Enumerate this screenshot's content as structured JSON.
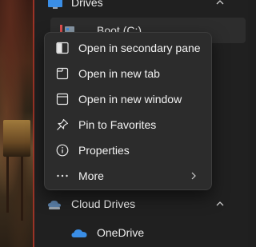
{
  "sidebar": {
    "drives_label": "Drives",
    "boot_label": "Boot (C:)",
    "cloud_label": "Cloud Drives",
    "onedrive_label": "OneDrive"
  },
  "context_menu": {
    "items": [
      {
        "label": "Open in secondary pane",
        "icon": "secondary-pane-icon"
      },
      {
        "label": "Open in new tab",
        "icon": "new-tab-icon"
      },
      {
        "label": "Open in new window",
        "icon": "new-window-icon"
      },
      {
        "label": "Pin to Favorites",
        "icon": "pin-icon"
      },
      {
        "label": "Properties",
        "icon": "info-icon"
      },
      {
        "label": "More",
        "icon": "more-icon",
        "has_submenu": true
      }
    ]
  },
  "colors": {
    "menu_bg": "#2c2c2c",
    "nav_bg": "#202020",
    "selected_row_bg": "#2d2d2d",
    "onedrive_blue": "#3a8ee6",
    "accent_red": "#c0392b"
  }
}
